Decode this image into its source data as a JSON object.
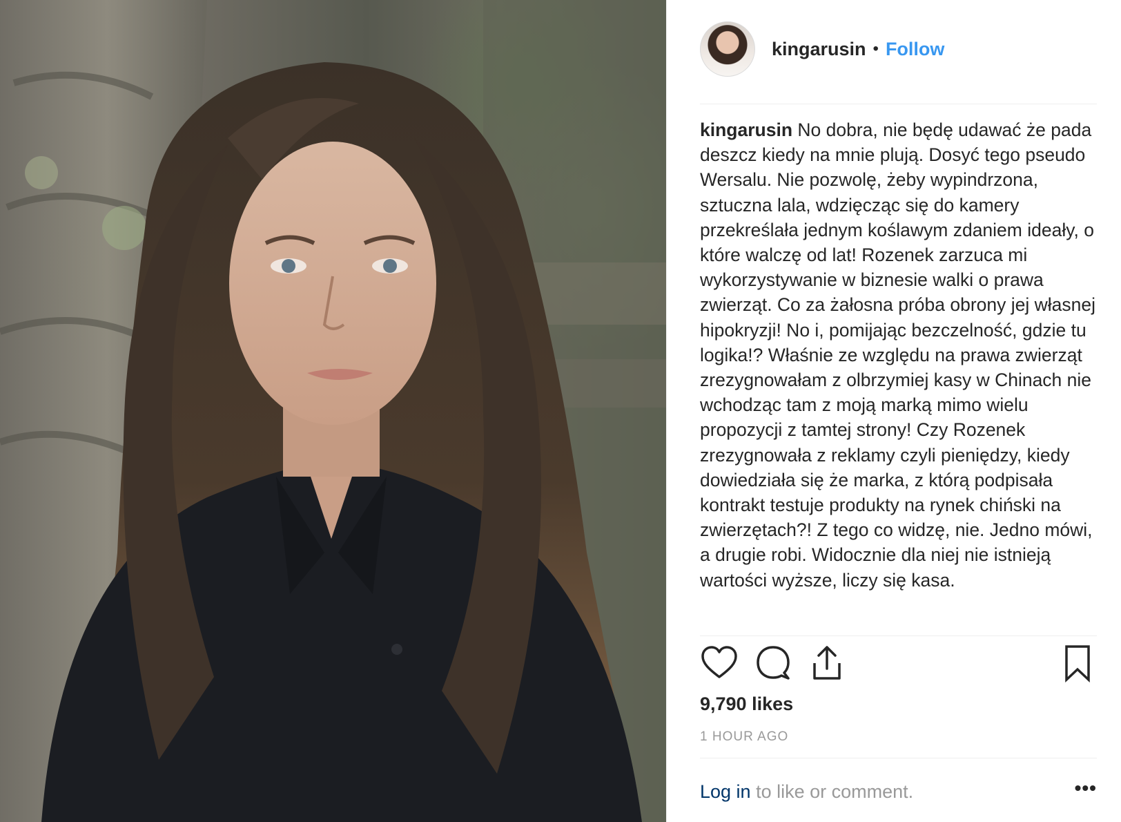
{
  "post": {
    "username": "kingarusin",
    "separator": "•",
    "follow_label": "Follow",
    "caption_text": "No dobra, nie będę udawać że pada deszcz kiedy na mnie plują. Dosyć tego pseudo Wersalu. Nie pozwolę, żeby wypindrzona, sztuczna lala, wdzięcząc się do kamery przekreślała jednym koślawym zdaniem ideały, o które walczę od lat! Rozenek zarzuca mi wykorzystywanie w biznesie walki o prawa zwierząt. Co za żałosna próba obrony jej własnej hipokryzji! No i, pomijając bezczelność, gdzie tu logika!? Właśnie ze względu na prawa zwierząt zrezygnowałam z olbrzymiej kasy w Chinach nie wchodząc tam z moją marką mimo wielu propozycji z tamtej strony! Czy Rozenek zrezygnowała z reklamy czyli pieniędzy, kiedy dowiedziała się że marka, z którą podpisała kontrakt testuje produkty na rynek chiński na zwierzętach?! Z tego co widzę, nie. Jedno mówi, a drugie robi. Widocznie dla niej nie istnieją wartości wyższe, liczy się kasa.",
    "likes": "9,790 likes",
    "time": "1 HOUR AGO",
    "login_link": "Log in",
    "login_rest": " to like or comment.",
    "more_label": "•••"
  },
  "icons": {
    "like": "heart-icon",
    "comment": "comment-icon",
    "share": "share-icon",
    "save": "bookmark-icon"
  },
  "colors": {
    "follow": "#3897f0",
    "text": "#262626",
    "muted": "#999999",
    "login": "#003569"
  }
}
